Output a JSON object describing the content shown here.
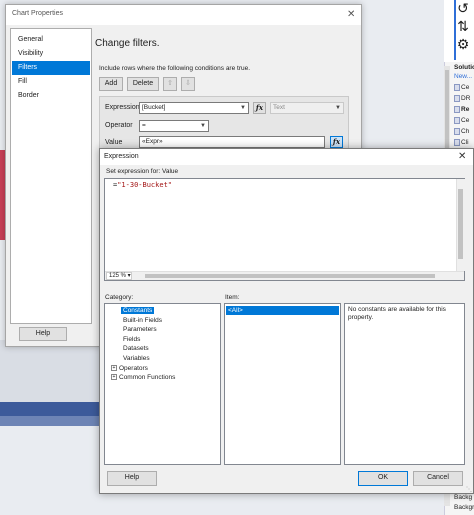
{
  "solution_panel": {
    "title": "Solutio",
    "new_link": "New...",
    "rows": [
      "Ce",
      "DR",
      "Re",
      "Ce",
      "Ch",
      "Cli"
    ],
    "bottom_rows": [
      "Backg",
      "Backgr"
    ]
  },
  "chart_properties": {
    "title": "Chart Properties",
    "nav": [
      "General",
      "Visibility",
      "Filters",
      "Fill",
      "Border"
    ],
    "selected_nav": "Filters",
    "heading": "Change filters.",
    "description": "Include rows where the following conditions are true.",
    "buttons": {
      "add": "Add",
      "delete": "Delete"
    },
    "filter": {
      "expression_label": "Expression",
      "expression_value": "[Bucket]",
      "type_value": "Text",
      "operator_label": "Operator",
      "operator_value": "=",
      "value_label": "Value",
      "value_value": "«Expr»"
    },
    "help": "Help"
  },
  "expression_dialog": {
    "title": "Expression",
    "set_label": "Set expression for: Value",
    "code_prefix": "=",
    "code_string": "\"1-30-Bucket\"",
    "zoom": "125 %",
    "category_label": "Category:",
    "item_label": "Item:",
    "categories": [
      {
        "label": "Constants",
        "selected": true,
        "expandable": false
      },
      {
        "label": "Built-in Fields",
        "selected": false,
        "expandable": false
      },
      {
        "label": "Parameters",
        "selected": false,
        "expandable": false
      },
      {
        "label": "Fields",
        "selected": false,
        "expandable": false
      },
      {
        "label": "Datasets",
        "selected": false,
        "expandable": false
      },
      {
        "label": "Variables",
        "selected": false,
        "expandable": false
      },
      {
        "label": "Operators",
        "selected": false,
        "expandable": true
      },
      {
        "label": "Common Functions",
        "selected": false,
        "expandable": true
      }
    ],
    "items": [
      "<All>"
    ],
    "description": "No constants are available for this property.",
    "buttons": {
      "help": "Help",
      "ok": "OK",
      "cancel": "Cancel"
    }
  }
}
